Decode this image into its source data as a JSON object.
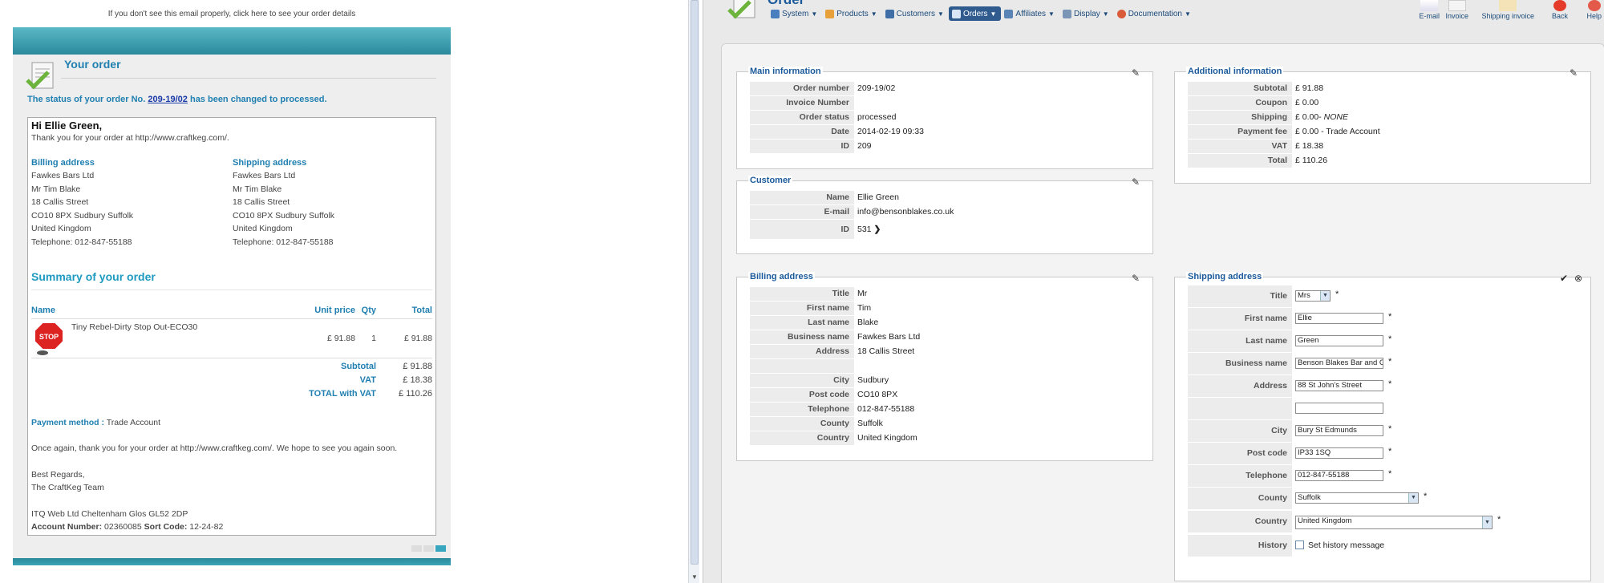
{
  "email": {
    "top_link": "If you don't see this email properly, click here to see your order details",
    "title": "Your order",
    "status_prefix": "The status of your order No.",
    "order_no": "209-19/02",
    "status_suffix": "has been changed to processed.",
    "greeting": "Hi Ellie Green,",
    "thanks": "Thank you for your order at http://www.craftkeg.com/.",
    "billing": {
      "heading": "Billing address",
      "lines": [
        "Fawkes Bars Ltd",
        "Mr Tim Blake",
        "18 Callis Street",
        "CO10 8PX Sudbury Suffolk",
        "United Kingdom",
        "Telephone: 012-847-55188"
      ]
    },
    "shipping": {
      "heading": "Shipping address",
      "lines": [
        "Fawkes Bars Ltd",
        "Mr Tim Blake",
        "18 Callis Street",
        "CO10 8PX Sudbury Suffolk",
        "United Kingdom",
        "Telephone: 012-847-55188"
      ]
    },
    "summary_title": "Summary of your order",
    "columns": {
      "name": "Name",
      "unit": "Unit price",
      "qty": "Qty",
      "total": "Total"
    },
    "item": {
      "name": "Tiny Rebel-Dirty Stop Out-ECO30",
      "unit": "£ 91.88",
      "qty": "1",
      "total": "£ 91.88",
      "image_text": "STOP"
    },
    "totals": [
      {
        "label": "Subtotal",
        "value": "£ 91.88"
      },
      {
        "label": "VAT",
        "value": "£ 18.38"
      },
      {
        "label": "TOTAL with VAT",
        "value": "£ 110.26"
      }
    ],
    "payment_label": "Payment method :",
    "payment_value": "Trade Account",
    "closing": "Once again, thank you for your order at http://www.craftkeg.com/. We hope to see you again soon.",
    "regards": "Best Regards,",
    "team": "The CraftKeg Team",
    "company": "ITQ Web Ltd Cheltenham Glos GL52 2DP",
    "account_label": "Account Number:",
    "account_value": "02360085",
    "sort_label": "Sort Code:",
    "sort_value": "12-24-82"
  },
  "admin": {
    "page_title": "Order",
    "nav": [
      {
        "label": "System",
        "icon": "wrench-icon",
        "color": "#4a7fbf"
      },
      {
        "label": "Products",
        "icon": "box-icon",
        "color": "#e8a13a"
      },
      {
        "label": "Customers",
        "icon": "users-icon",
        "color": "#3f6fa6"
      },
      {
        "label": "Orders",
        "icon": "cart-icon",
        "color": "#d9e6f5"
      },
      {
        "label": "Affiliates",
        "icon": "people-icon",
        "color": "#5a84b6"
      },
      {
        "label": "Display",
        "icon": "monitor-icon",
        "color": "#7a95b5"
      },
      {
        "label": "Documentation",
        "icon": "lifebuoy-icon",
        "color": "#d95b3a"
      }
    ],
    "tools": [
      {
        "label": "E-mail",
        "icon": "email-icon"
      },
      {
        "label": "Invoice",
        "icon": "invoice-icon"
      },
      {
        "label": "Shipping invoice",
        "icon": "shipping-invoice-icon"
      },
      {
        "label": "Back",
        "icon": "back-icon"
      },
      {
        "label": "Help",
        "icon": "help-icon"
      }
    ],
    "main_info": {
      "legend": "Main information",
      "rows": [
        {
          "k": "Order number",
          "v": "209-19/02"
        },
        {
          "k": "Invoice Number",
          "v": ""
        },
        {
          "k": "Order status",
          "v": "processed"
        },
        {
          "k": "Date",
          "v": "2014-02-19 09:33"
        },
        {
          "k": "ID",
          "v": "209"
        }
      ]
    },
    "additional_info": {
      "legend": "Additional information",
      "rows": [
        {
          "k": "Subtotal",
          "v": "£ 91.88"
        },
        {
          "k": "Coupon",
          "v": "£ 0.00"
        },
        {
          "k": "Shipping",
          "v": "£ 0.00-",
          "v2": "NONE"
        },
        {
          "k": "Payment fee",
          "v": "£ 0.00 - Trade Account"
        },
        {
          "k": "VAT",
          "v": "£ 18.38"
        },
        {
          "k": "Total",
          "v": "£ 110.26"
        }
      ]
    },
    "customer": {
      "legend": "Customer",
      "rows": [
        {
          "k": "Name",
          "v": "Ellie Green"
        },
        {
          "k": "E-mail",
          "v": "info@bensonblakes.co.uk"
        },
        {
          "k": "ID",
          "v": "531"
        }
      ]
    },
    "billing": {
      "legend": "Billing address",
      "rows": [
        {
          "k": "Title",
          "v": "Mr"
        },
        {
          "k": "First name",
          "v": "Tim"
        },
        {
          "k": "Last name",
          "v": "Blake"
        },
        {
          "k": "Business name",
          "v": "Fawkes Bars Ltd"
        },
        {
          "k": "Address",
          "v": "18 Callis Street"
        },
        {
          "k": "",
          "v": ""
        },
        {
          "k": "City",
          "v": "Sudbury"
        },
        {
          "k": "Post code",
          "v": "CO10 8PX"
        },
        {
          "k": "Telephone",
          "v": "012-847-55188"
        },
        {
          "k": "County",
          "v": "Suffolk"
        },
        {
          "k": "Country",
          "v": "United Kingdom"
        }
      ]
    },
    "shipping": {
      "legend": "Shipping address",
      "title_label": "Title",
      "title_value": "Mrs",
      "first_label": "First name",
      "first_value": "Ellie",
      "last_label": "Last name",
      "last_value": "Green",
      "business_label": "Business name",
      "business_value": "Benson Blakes Bar and G",
      "address_label": "Address",
      "address_value": "88 St John's Street",
      "address2_value": "",
      "city_label": "City",
      "city_value": "Bury St Edmunds",
      "post_label": "Post code",
      "post_value": "IP33 1SQ",
      "phone_label": "Telephone",
      "phone_value": "012-847-55188",
      "county_label": "County",
      "county_value": "Suffolk",
      "country_label": "Country",
      "country_value": "United Kingdom",
      "history_label": "History",
      "history_text": "Set history message",
      "required_mark": "*"
    }
  }
}
